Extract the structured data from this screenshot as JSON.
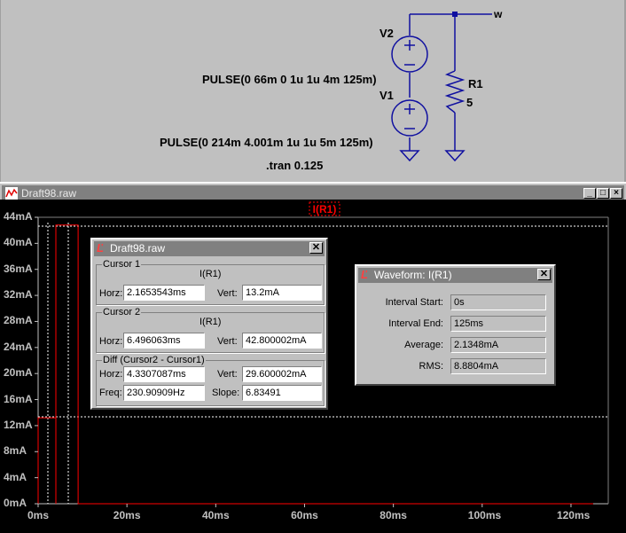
{
  "schematic": {
    "v2_label": "V2",
    "v1_label": "V1",
    "r1_label": "R1",
    "r1_value": "5",
    "net_label": "w",
    "v2_pulse": "PULSE(0 66m 0 1u 1u 4m 125m)",
    "v1_pulse": "PULSE(0 214m 4.001m 1u 1u 5m 125m)",
    "tran_directive": ".tran 0.125"
  },
  "window": {
    "title": "Draft98.raw",
    "trace_label": "I(R1)"
  },
  "chart_data": {
    "type": "line",
    "title": "I(R1)",
    "xlabel": "",
    "ylabel": "",
    "x_ticks": [
      "0ms",
      "20ms",
      "40ms",
      "60ms",
      "80ms",
      "100ms",
      "120ms"
    ],
    "y_ticks": [
      "0mA",
      "4mA",
      "8mA",
      "12mA",
      "16mA",
      "20mA",
      "24mA",
      "28mA",
      "32mA",
      "36mA",
      "40mA",
      "44mA"
    ],
    "xlim": [
      0,
      125
    ],
    "ylim": [
      0,
      44
    ],
    "grid": false,
    "series": [
      {
        "color": "#ff0000",
        "x": [
          0,
          0,
          4,
          4,
          4.001,
          4.001,
          9.001,
          9.001,
          125
        ],
        "y": [
          0,
          13.2,
          13.2,
          0,
          0,
          42.8,
          42.8,
          0,
          0
        ]
      }
    ]
  },
  "cursor_dialog": {
    "title": "Draft98.raw",
    "cursor1": {
      "group": "Cursor 1",
      "trace": "I(R1)",
      "horz_label": "Horz:",
      "horz": "2.1653543ms",
      "vert_label": "Vert:",
      "vert": "13.2mA"
    },
    "cursor2": {
      "group": "Cursor 2",
      "trace": "I(R1)",
      "horz_label": "Horz:",
      "horz": "6.496063ms",
      "vert_label": "Vert:",
      "vert": "42.800002mA"
    },
    "diff": {
      "group": "Diff (Cursor2 - Cursor1)",
      "horz_label": "Horz:",
      "horz": "4.3307087ms",
      "vert_label": "Vert:",
      "vert": "29.600002mA",
      "freq_label": "Freq:",
      "freq": "230.90909Hz",
      "slope_label": "Slope:",
      "slope": "6.83491"
    }
  },
  "waveform_dialog": {
    "title": "Waveform: I(R1)",
    "interval_start_label": "Interval Start:",
    "interval_start": "0s",
    "interval_end_label": "Interval End:",
    "interval_end": "125ms",
    "average_label": "Average:",
    "average": "2.1348mA",
    "rms_label": "RMS:",
    "rms": "8.8804mA"
  }
}
